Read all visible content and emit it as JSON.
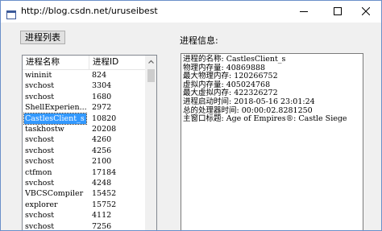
{
  "window": {
    "title": "http://blog.csdn.net/uruseibest"
  },
  "toolbar": {
    "list_button_label": "进程列表"
  },
  "info_label": "进程信息:",
  "process_list": {
    "columns": [
      "进程名称",
      "进程ID"
    ],
    "rows": [
      {
        "name": "wininit",
        "pid": "824"
      },
      {
        "name": "svchost",
        "pid": "3304"
      },
      {
        "name": "svchost",
        "pid": "1680"
      },
      {
        "name": "ShellExperien...",
        "pid": "2972"
      },
      {
        "name": "CastlesClient_s",
        "pid": "10820",
        "selected": true
      },
      {
        "name": "taskhostw",
        "pid": "20208"
      },
      {
        "name": "svchost",
        "pid": "4260"
      },
      {
        "name": "svchost",
        "pid": "4256"
      },
      {
        "name": "svchost",
        "pid": "2100"
      },
      {
        "name": "ctfmon",
        "pid": "17184"
      },
      {
        "name": "svchost",
        "pid": "4248"
      },
      {
        "name": "VBCSCompiler",
        "pid": "15452"
      },
      {
        "name": "explorer",
        "pid": "15752"
      },
      {
        "name": "svchost",
        "pid": "4112"
      },
      {
        "name": "svchost",
        "pid": "7256"
      }
    ]
  },
  "process_info": {
    "lines": [
      "进程的名称: CastlesClient_s",
      "物理内存量: 40869888",
      "最大物理内存: 120266752",
      "虚拟内存量: 405024768",
      "最大虚拟内存: 422326272",
      "进程启动时间: 2018-05-16 23:01:24",
      "总的处理器时间: 00:00:02.8281250",
      "主窗口标题: Age of Empires®: Castle Siege"
    ]
  },
  "icons": {
    "app": "app-window-icon",
    "minimize": "minimize-icon",
    "maximize": "maximize-icon",
    "close": "close-icon",
    "scroll_up": "chevron-up-icon",
    "scroll_down": "chevron-down-icon"
  },
  "colors": {
    "selection": "#3399ff",
    "window_border": "#6b8fc9",
    "client_bg": "#f0f0f0"
  }
}
